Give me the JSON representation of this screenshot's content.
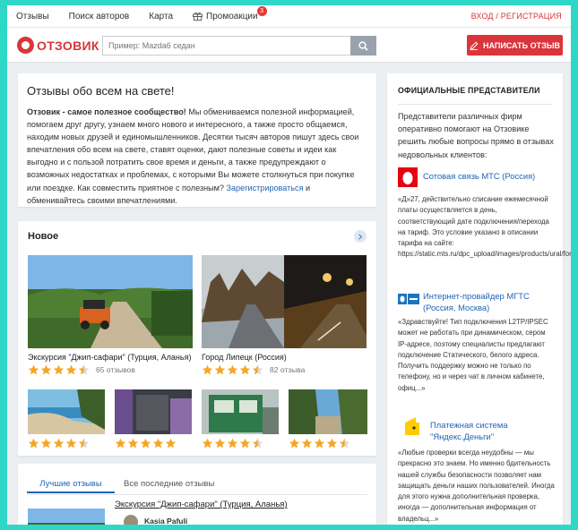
{
  "topnav": {
    "items": [
      "Отзывы",
      "Поиск авторов",
      "Карта",
      "Промоакции"
    ],
    "promo_badge": "3",
    "login": "ВХОД / РЕГИСТРАЦИЯ"
  },
  "header": {
    "logo_text": "ОТЗОВИК",
    "search_placeholder": "Пример: Mazda6 седан",
    "write_button": "НАПИСАТЬ ОТЗЫВ"
  },
  "about": {
    "title": "Отзывы обо всем на свете!",
    "lead": "Отзовик - самое полезное сообщество!",
    "body": " Мы обмениваемся полезной информацией, помогаем друг другу, узнаем много нового и интересного, а также просто общаемся, находим новых друзей и единомышленников. Десятки тысяч авторов пишут здесь свои впечатления обо всем на свете, ставят оценки, дают полезные советы и идеи как выгодно и с пользой потратить свое время и деньги, а также предупреждают о возможных недостатках и проблемах, с которыми Вы можете столкнуться при покупке или поездке. Как совместить приятное с полезным? ",
    "link": "Зарегистрироваться",
    "tail": " и обменивайтесь своими впечатлениями."
  },
  "new_section": {
    "title": "Новое",
    "items": [
      {
        "caption": "Экскурсия \"Джип-сафари\" (Турция, Аланья)",
        "rating": 4.5,
        "count": "65 отзывов"
      },
      {
        "caption": "Город Липецк (Россия)",
        "rating": 4.5,
        "count": "82 отзыва"
      },
      {
        "rating": 4.5
      },
      {
        "rating": 5
      },
      {
        "rating": 4.5
      },
      {
        "rating": 4.5
      }
    ]
  },
  "tabs": {
    "active": "Лучшие отзывы",
    "other": "Все последние отзывы",
    "best_title": "Экскурсия \"Джип-сафари\" (Турция, Аланья)",
    "best_author": "Kasia Pafuli"
  },
  "reps": {
    "title": "ОФИЦИАЛЬНЫЕ ПРЕДСТАВИТЕЛИ",
    "intro": "Представители различных фирм оперативно помогают на Отзовике решить любые вопросы прямо в отзывах недовольных клиентов:",
    "items": [
      {
        "name": "Сотовая связь МТС (Россия)",
        "text": "«Д»27, действительно списание ежемесячной платы осуществляется в день, соответствующий дате подключения/перехода на тариф. Это условие указано в описании тарифа на сайте: https://static.mts.ru/dpc_upload/images/products/ural/for_notebooks_tyumen_260520.pdf»"
      },
      {
        "name": "Интернет-провайдер МГТС (Россия, Москва)",
        "text": "«Здравствуйте! Тип подключения L2TP/IPSEC может не работать при динамическом, сером IP-адресе, поэтому специалисты предлагают подключение Статического, белого адреса. Получить поддержку можно не только по телефону, но и через чат в личном кабинете, офиц...»"
      },
      {
        "name": "Платежная система \"Яндекс.Деньги\"",
        "text": "«Любые проверки всегда неудобны — мы прекрасно это знаем. Но именно бдительность нашей службы безопасности позволяет нам защищать деньги наших пользователей. Иногда для этого нужна дополнительная проверка, иногда — дополнительная информация от владельц...»"
      }
    ]
  },
  "colors": {
    "brand": "#d9353a",
    "link": "#1e63b5",
    "star": "#f5a623",
    "border_frame": "#2fd8c6"
  }
}
